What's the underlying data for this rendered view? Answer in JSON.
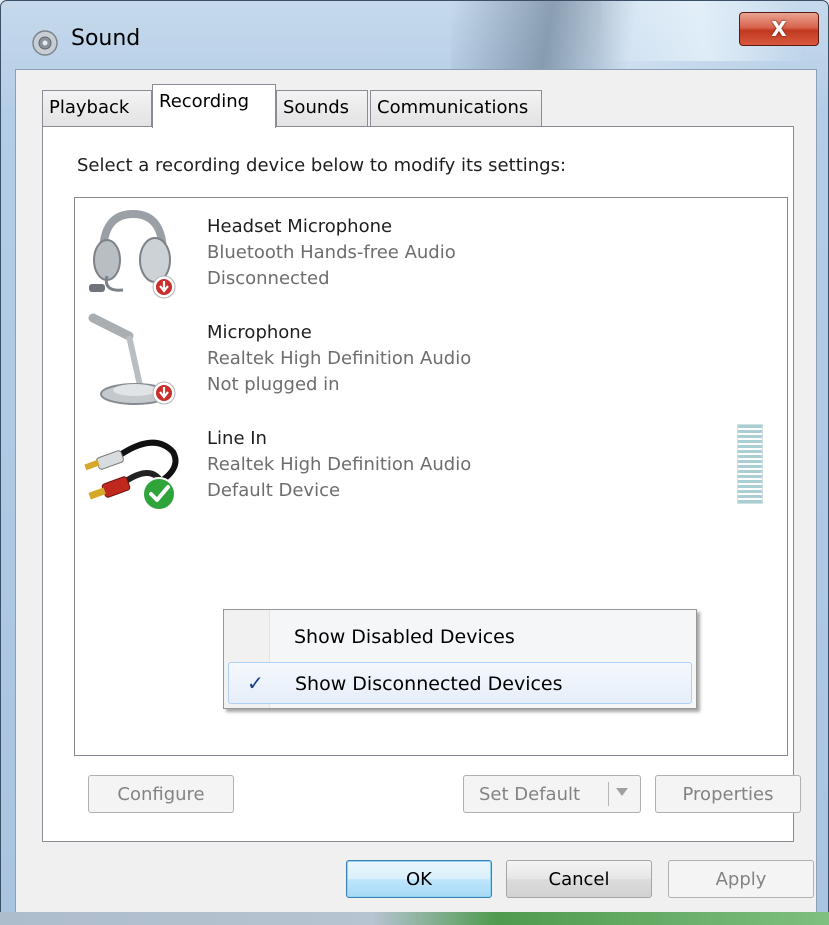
{
  "window": {
    "title": "Sound",
    "close_label": "X"
  },
  "tabs": [
    {
      "label": "Playback",
      "active": false
    },
    {
      "label": "Recording",
      "active": true
    },
    {
      "label": "Sounds",
      "active": false
    },
    {
      "label": "Communications",
      "active": false
    }
  ],
  "recording": {
    "instruction": "Select a recording device below to modify its settings:",
    "devices": [
      {
        "name": "Headset Microphone",
        "driver": "Bluetooth Hands-free Audio",
        "status": "Disconnected",
        "icon": "headset-icon",
        "badge": "disconnected-badge-icon"
      },
      {
        "name": "Microphone",
        "driver": "Realtek High Definition Audio",
        "status": "Not plugged in",
        "icon": "microphone-icon",
        "badge": "unplugged-badge-icon"
      },
      {
        "name": "Line In",
        "driver": "Realtek High Definition Audio",
        "status": "Default Device",
        "icon": "line-in-cable-icon",
        "badge": "default-check-badge-icon"
      }
    ]
  },
  "context_menu": {
    "items": [
      {
        "label": "Show Disabled Devices",
        "checked": false
      },
      {
        "label": "Show Disconnected Devices",
        "checked": true
      }
    ],
    "check_glyph": "✓"
  },
  "panel_buttons": {
    "configure": "Configure",
    "set_default": "Set Default",
    "properties": "Properties"
  },
  "dialog_buttons": {
    "ok": "OK",
    "cancel": "Cancel",
    "apply": "Apply"
  },
  "colors": {
    "close_button": "#c0391f",
    "disabled_text": "#838383",
    "level_meter": "#a9cfd3",
    "check_badge": "#2ea43a",
    "warning_badge": "#c9302c"
  }
}
